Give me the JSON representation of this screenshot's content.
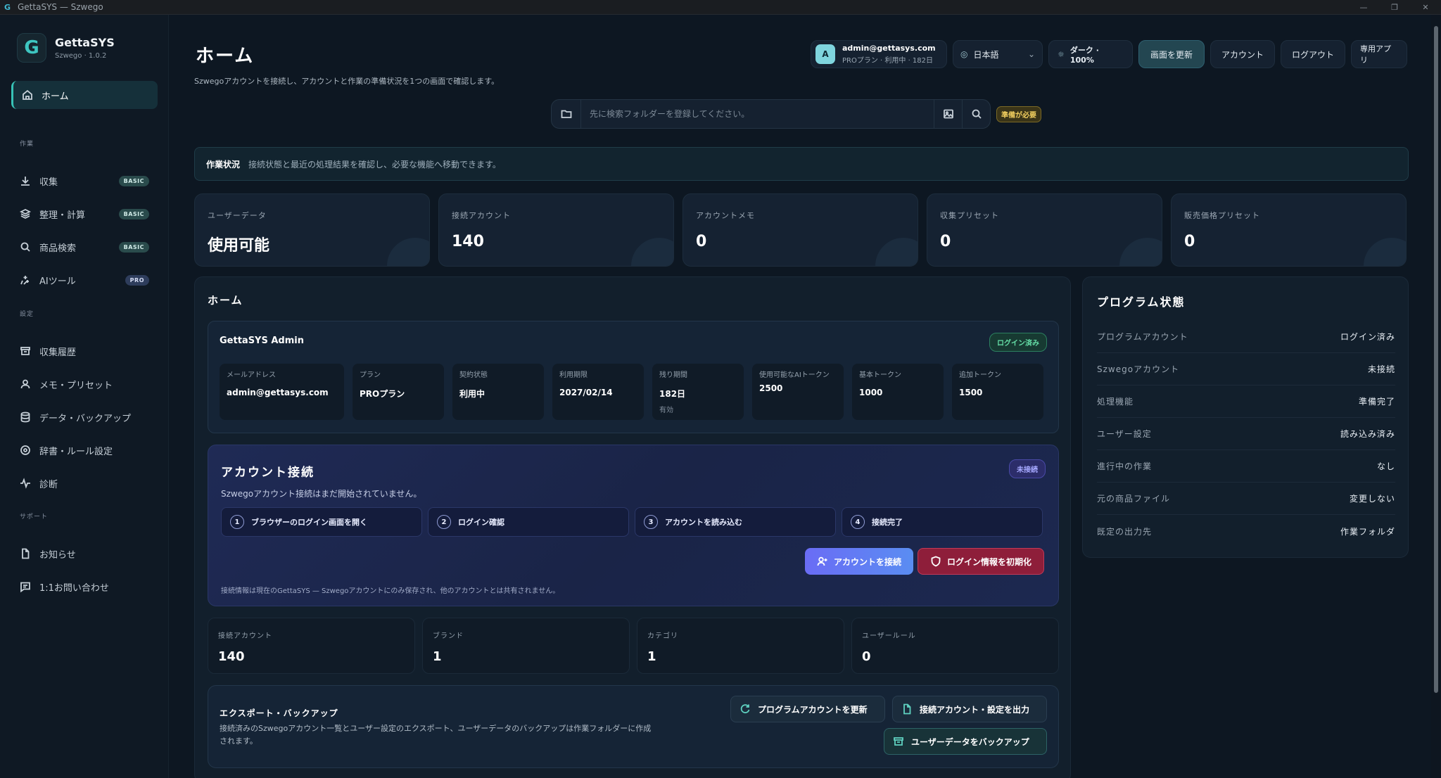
{
  "window": {
    "title": "GettaSYS — Szwego"
  },
  "brand": {
    "name": "GettaSYS",
    "version": "Szwego · 1.0.2"
  },
  "sidebar": {
    "home": "ホーム",
    "sec_work": "作業",
    "collect": "収集",
    "collect_badge": "BASIC",
    "organize": "整理・計算",
    "organize_badge": "BASIC",
    "product_search": "商品検索",
    "product_search_badge": "BASIC",
    "ai_tools": "AIツール",
    "ai_tools_badge": "PRO",
    "sec_settings": "設定",
    "history": "収集履歴",
    "memo": "メモ・プリセット",
    "backup": "データ・バックアップ",
    "dict": "辞書・ルール設定",
    "diag": "診断",
    "sec_support": "サポート",
    "notice": "お知らせ",
    "contact": "1:1お問い合わせ"
  },
  "header": {
    "title": "ホーム",
    "subtitle": "Szwegoアカウントを接続し、アカウントと作業の準備状況を1つの画面で確認します。",
    "user_avatar": "A",
    "user_email": "admin@gettasys.com",
    "user_plan": "PROプラン · 利用中 · 182日",
    "language": "日本語",
    "theme": "ダーク · 100%",
    "refresh": "画面を更新",
    "account": "アカウント",
    "logout": "ログアウト",
    "app": "専用アプリ"
  },
  "search": {
    "placeholder": "先に検索フォルダーを登録してください。",
    "status": "準備が必要"
  },
  "status_strip": {
    "label": "作業状況",
    "text": "接続状態と最近の処理結果を確認し、必要な機能へ移動できます。"
  },
  "stats": [
    {
      "label": "ユーザーデータ",
      "value": "使用可能"
    },
    {
      "label": "接続アカウント",
      "value": "140"
    },
    {
      "label": "アカウントメモ",
      "value": "0"
    },
    {
      "label": "収集プリセット",
      "value": "0"
    },
    {
      "label": "販売価格プリセット",
      "value": "0"
    }
  ],
  "home_panel": {
    "title": "ホーム",
    "account_name": "GettaSYS Admin",
    "login_status": "ログイン済み",
    "info": [
      {
        "label": "メールアドレス",
        "value": "admin@gettasys.com",
        "sub": ""
      },
      {
        "label": "プラン",
        "value": "PROプラン",
        "sub": ""
      },
      {
        "label": "契約状態",
        "value": "利用中",
        "sub": ""
      },
      {
        "label": "利用期限",
        "value": "2027/02/14",
        "sub": ""
      },
      {
        "label": "残り期間",
        "value": "182日",
        "sub": "有効"
      },
      {
        "label": "使用可能なAIトークン",
        "value": "2500",
        "sub": ""
      },
      {
        "label": "基本トークン",
        "value": "1000",
        "sub": ""
      },
      {
        "label": "追加トークン",
        "value": "1500",
        "sub": ""
      }
    ],
    "connect": {
      "title": "アカウント接続",
      "subtitle": "Szwegoアカウント接続はまだ開始されていません。",
      "status": "未接続",
      "steps": [
        {
          "num": "1",
          "label": "ブラウザーのログイン画面を開く"
        },
        {
          "num": "2",
          "label": "ログイン確認"
        },
        {
          "num": "3",
          "label": "アカウントを読み込む"
        },
        {
          "num": "4",
          "label": "接続完了"
        }
      ],
      "connect_btn": "アカウントを接続",
      "reset_btn": "ログイン情報を初期化",
      "note": "接続情報は現在のGettaSYS — Szwegoアカウントにのみ保存され、他のアカウントとは共有されません。"
    },
    "mini": [
      {
        "label": "接続アカウント",
        "value": "140"
      },
      {
        "label": "ブランド",
        "value": "1"
      },
      {
        "label": "カテゴリ",
        "value": "1"
      },
      {
        "label": "ユーザールール",
        "value": "0"
      }
    ],
    "export": {
      "title": "エクスポート・バックアップ",
      "desc": "接続済みのSzwegoアカウント一覧とユーザー設定のエクスポート、ユーザーデータのバックアップは作業フォルダーに作成されます。",
      "btn_update": "プログラムアカウントを更新",
      "btn_export": "接続アカウント・設定を出力",
      "btn_backup": "ユーザーデータをバックアップ"
    }
  },
  "program": {
    "title": "プログラム状態",
    "rows": [
      {
        "label": "プログラムアカウント",
        "value": "ログイン済み"
      },
      {
        "label": "Szwegoアカウント",
        "value": "未接続"
      },
      {
        "label": "処理機能",
        "value": "準備完了"
      },
      {
        "label": "ユーザー設定",
        "value": "読み込み済み"
      },
      {
        "label": "進行中の作業",
        "value": "なし"
      },
      {
        "label": "元の商品ファイル",
        "value": "変更しない"
      },
      {
        "label": "既定の出力先",
        "value": "作業フォルダ"
      }
    ]
  }
}
